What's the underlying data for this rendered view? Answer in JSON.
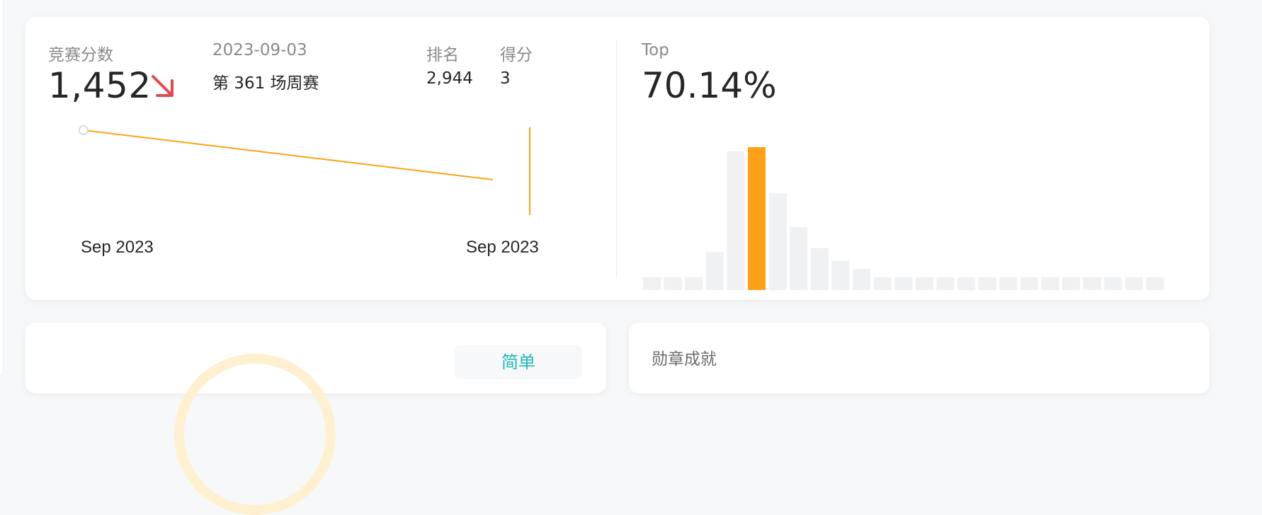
{
  "contest": {
    "rating_label": "竞赛分数",
    "rating_value": "1,452",
    "trend": "down",
    "trend_color": "#e5484d",
    "date": "2023-09-03",
    "contest_name": "第 361 场周赛",
    "rank_label": "排名",
    "rank_value": "2,944",
    "score_label": "得分",
    "score_value": "3",
    "top_label": "Top",
    "top_value": "70.14%"
  },
  "chart_data": [
    {
      "type": "line",
      "x": [
        "Sep 2023",
        "Sep 2023"
      ],
      "series": [
        {
          "values": [
            1500,
            1452
          ]
        }
      ],
      "xlabel": "",
      "ylabel": "",
      "line_color": "#ffa116",
      "grid": false
    },
    {
      "type": "bar",
      "values": [
        3,
        3,
        3,
        9,
        33,
        34,
        23,
        15,
        10,
        7,
        5,
        3,
        3,
        3,
        3,
        3,
        3,
        3,
        3,
        3,
        3,
        3,
        3,
        3,
        3
      ],
      "highlight_index": 5,
      "highlight_color": "#ffa116",
      "bar_color": "#f0f1f3",
      "grid": false
    }
  ],
  "solved": {
    "difficulty_easy": "简单"
  },
  "badges": {
    "title": "勋章成就"
  }
}
